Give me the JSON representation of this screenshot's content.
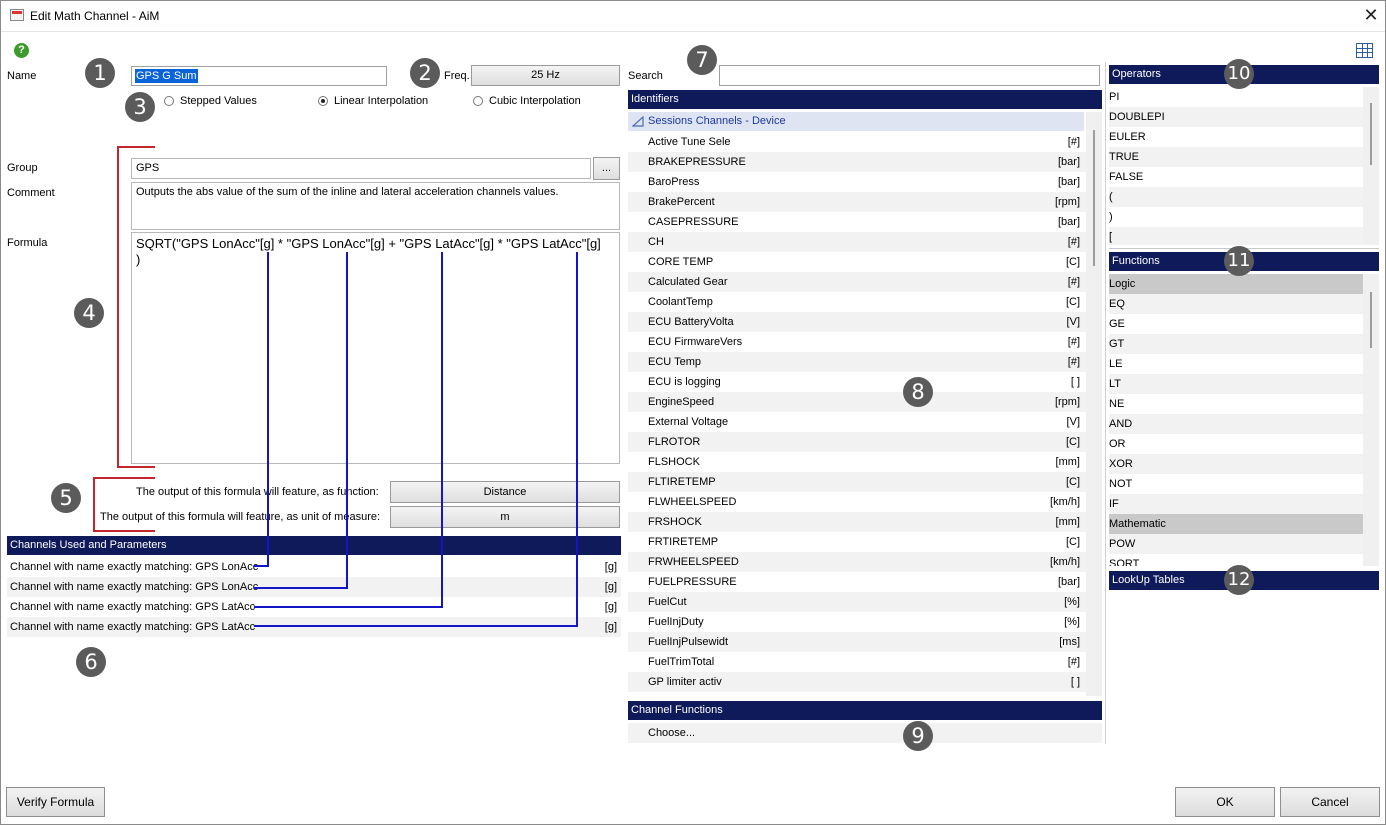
{
  "window": {
    "title": "Edit Math Channel - AiM"
  },
  "name_field": {
    "label": "Name",
    "value": "GPS G Sum"
  },
  "freq": {
    "label": "Freq.",
    "value": "25 Hz"
  },
  "interpolation": {
    "options": [
      "Stepped Values",
      "Linear Interpolation",
      "Cubic Interpolation"
    ],
    "selected": "Linear Interpolation"
  },
  "group": {
    "label": "Group",
    "value": "GPS",
    "browse": "..."
  },
  "comment": {
    "label": "Comment",
    "value": "Outputs the abs value of the sum of the inline and lateral acceleration channels values."
  },
  "formula": {
    "label": "Formula",
    "line1": "SQRT(\"GPS LonAcc\"[g] * \"GPS LonAcc\"[g] + \"GPS LatAcc\"[g] * \"GPS LatAcc\"[g]",
    "line2": ")"
  },
  "output": {
    "function_label": "The output of this formula will feature, as function:",
    "function_value": "Distance",
    "unit_label": "The output of this formula will feature, as unit of measure:",
    "unit_value": "m"
  },
  "channels_used": {
    "header": "Channels Used and Parameters",
    "rows": [
      {
        "text": "Channel with name exactly matching: GPS LonAcc",
        "unit": "[g]"
      },
      {
        "text": "Channel with name exactly matching: GPS LonAcc",
        "unit": "[g]"
      },
      {
        "text": "Channel with name exactly matching: GPS LatAcc",
        "unit": "[g]"
      },
      {
        "text": "Channel with name exactly matching: GPS LatAcc",
        "unit": "[g]"
      }
    ]
  },
  "search": {
    "label": "Search",
    "value": ""
  },
  "identifiers": {
    "header": "Identifiers",
    "group_label": "Sessions Channels - Device",
    "items": [
      {
        "name": "Active Tune Sele",
        "unit": "[#]"
      },
      {
        "name": "BRAKEPRESSURE",
        "unit": "[bar]"
      },
      {
        "name": "BaroPress",
        "unit": "[bar]"
      },
      {
        "name": "BrakePercent",
        "unit": "[rpm]"
      },
      {
        "name": "CASEPRESSURE",
        "unit": "[bar]"
      },
      {
        "name": "CH",
        "unit": "[#]"
      },
      {
        "name": "CORE TEMP",
        "unit": "[C]"
      },
      {
        "name": "Calculated Gear",
        "unit": "[#]"
      },
      {
        "name": "CoolantTemp",
        "unit": "[C]"
      },
      {
        "name": "ECU BatteryVolta",
        "unit": "[V]"
      },
      {
        "name": "ECU FirmwareVers",
        "unit": "[#]"
      },
      {
        "name": "ECU Temp",
        "unit": "[#]"
      },
      {
        "name": "ECU is logging",
        "unit": "[ ]"
      },
      {
        "name": "EngineSpeed",
        "unit": "[rpm]"
      },
      {
        "name": "External Voltage",
        "unit": "[V]"
      },
      {
        "name": "FLROTOR",
        "unit": "[C]"
      },
      {
        "name": "FLSHOCK",
        "unit": "[mm]"
      },
      {
        "name": "FLTIRETEMP",
        "unit": "[C]"
      },
      {
        "name": "FLWHEELSPEED",
        "unit": "[km/h]"
      },
      {
        "name": "FRSHOCK",
        "unit": "[mm]"
      },
      {
        "name": "FRTIRETEMP",
        "unit": "[C]"
      },
      {
        "name": "FRWHEELSPEED",
        "unit": "[km/h]"
      },
      {
        "name": "FUELPRESSURE",
        "unit": "[bar]"
      },
      {
        "name": "FuelCut",
        "unit": "[%]"
      },
      {
        "name": "FuelInjDuty",
        "unit": "[%]"
      },
      {
        "name": "FuelInjPulsewidt",
        "unit": "[ms]"
      },
      {
        "name": "FuelTrimTotal",
        "unit": "[#]"
      },
      {
        "name": "GP limiter activ",
        "unit": "[ ]"
      }
    ]
  },
  "channel_functions": {
    "header": "Channel Functions",
    "choose": "Choose..."
  },
  "operators": {
    "header": "Operators",
    "items": [
      "PI",
      "DOUBLEPI",
      "EULER",
      "TRUE",
      "FALSE",
      "(",
      ")",
      "["
    ]
  },
  "functions": {
    "header": "Functions",
    "items": [
      {
        "name": "Logic",
        "category": true
      },
      {
        "name": "EQ"
      },
      {
        "name": "GE"
      },
      {
        "name": "GT"
      },
      {
        "name": "LE"
      },
      {
        "name": "LT"
      },
      {
        "name": "NE"
      },
      {
        "name": "AND"
      },
      {
        "name": "OR"
      },
      {
        "name": "XOR"
      },
      {
        "name": "NOT"
      },
      {
        "name": "IF"
      },
      {
        "name": "Mathematic",
        "category": true
      },
      {
        "name": "POW"
      },
      {
        "name": "SQRT"
      }
    ]
  },
  "lookup_tables": {
    "header": "LookUp Tables"
  },
  "footer": {
    "verify": "Verify Formula",
    "ok": "OK",
    "cancel": "Cancel"
  },
  "badges": [
    "1",
    "2",
    "3",
    "4",
    "5",
    "6",
    "7",
    "8",
    "9",
    "10",
    "11",
    "12"
  ],
  "icons": {
    "help": "help-icon",
    "grid": "table-grid-icon",
    "close": "close-icon",
    "group_triangle": "collapse-triangle-icon"
  },
  "colors": {
    "header_bg": "#0f1a5a",
    "accent_bracket": "#c0282d",
    "connector": "#1515c8",
    "help_green": "#3d9a2c"
  }
}
